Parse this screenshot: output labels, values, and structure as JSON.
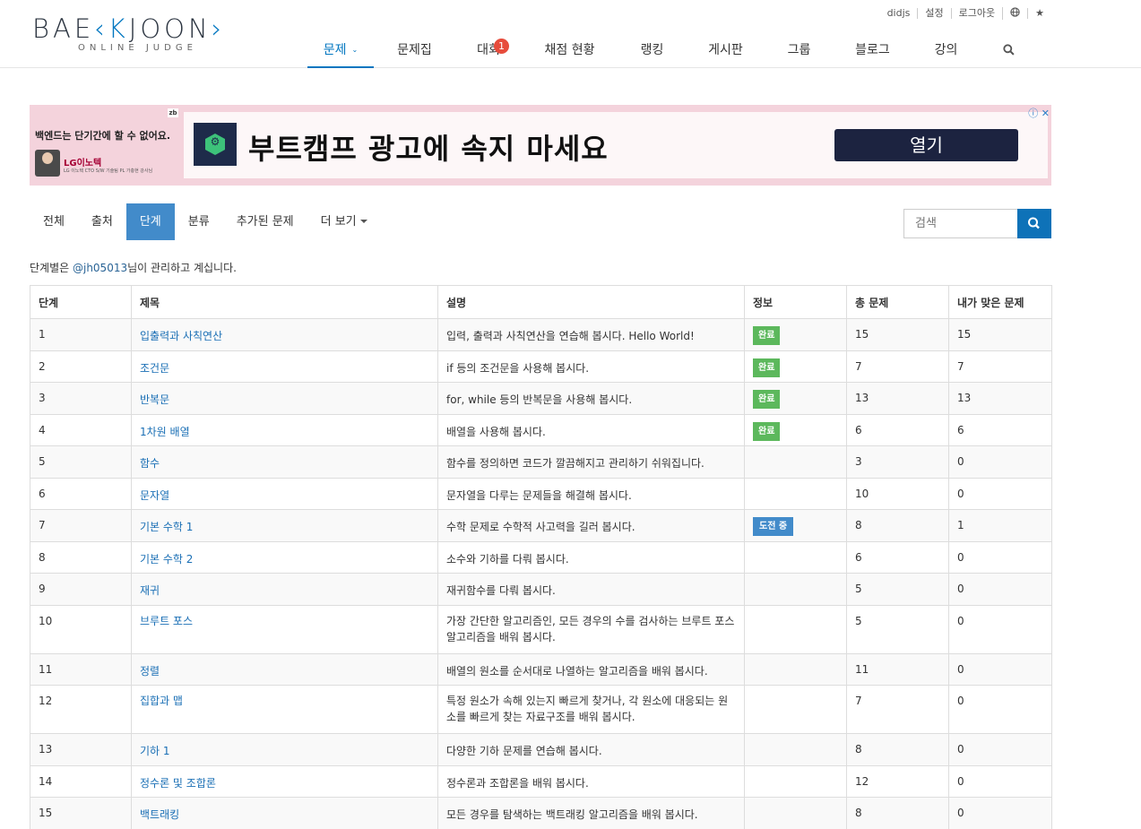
{
  "logo": {
    "main_a": "BAE",
    "main_k": "K",
    "main_b": "JOON",
    "sub": "ONLINE JUDGE"
  },
  "top_links": [
    "didjs",
    "설정",
    "로그아웃"
  ],
  "nav": {
    "items": [
      {
        "label": "문제",
        "active": true
      },
      {
        "label": "문제집"
      },
      {
        "label": "대회",
        "badge": "1"
      },
      {
        "label": "채점 현황"
      },
      {
        "label": "랭킹"
      },
      {
        "label": "게시판"
      },
      {
        "label": "그룹"
      },
      {
        "label": "블로그"
      },
      {
        "label": "강의"
      }
    ]
  },
  "ad": {
    "left_text": "백엔드는 단기간에 할 수 없어요.",
    "zb": "zb",
    "lg": "LG이노텍",
    "lg_sub": "LG 이노텍 CTO S/W 기술팀 PL 가충현 강사님",
    "headline": "부트캠프 광고에 속지 마세요",
    "button": "열기"
  },
  "subnav": {
    "tabs": [
      {
        "label": "전체"
      },
      {
        "label": "출처"
      },
      {
        "label": "단계",
        "active": true
      },
      {
        "label": "분류"
      },
      {
        "label": "추가된 문제"
      },
      {
        "label": "더 보기"
      }
    ]
  },
  "search": {
    "placeholder": "검색"
  },
  "manager": {
    "prefix": "단계별은 ",
    "user": "@jh05013",
    "suffix": "님이 관리하고 계십니다."
  },
  "table": {
    "headers": [
      "단계",
      "제목",
      "설명",
      "정보",
      "총 문제",
      "내가 맞은 문제"
    ],
    "rows": [
      {
        "step": "1",
        "title": "입출력과 사칙연산",
        "desc": "입력, 출력과 사칙연산을 연습해 봅시다. Hello World!",
        "info": "완료",
        "total": "15",
        "solved": "15"
      },
      {
        "step": "2",
        "title": "조건문",
        "desc": "if 등의 조건문을 사용해 봅시다.",
        "info": "완료",
        "total": "7",
        "solved": "7"
      },
      {
        "step": "3",
        "title": "반복문",
        "desc": "for, while 등의 반복문을 사용해 봅시다.",
        "info": "완료",
        "total": "13",
        "solved": "13"
      },
      {
        "step": "4",
        "title": "1차원 배열",
        "desc": "배열을 사용해 봅시다.",
        "info": "완료",
        "total": "6",
        "solved": "6"
      },
      {
        "step": "5",
        "title": "함수",
        "desc": "함수를 정의하면 코드가 깔끔해지고 관리하기 쉬워집니다.",
        "info": "",
        "total": "3",
        "solved": "0"
      },
      {
        "step": "6",
        "title": "문자열",
        "desc": "문자열을 다루는 문제들을 해결해 봅시다.",
        "info": "",
        "total": "10",
        "solved": "0"
      },
      {
        "step": "7",
        "title": "기본 수학 1",
        "desc": "수학 문제로 수학적 사고력을 길러 봅시다.",
        "info": "도전 중",
        "total": "8",
        "solved": "1"
      },
      {
        "step": "8",
        "title": "기본 수학 2",
        "desc": "소수와 기하를 다뤄 봅시다.",
        "info": "",
        "total": "6",
        "solved": "0"
      },
      {
        "step": "9",
        "title": "재귀",
        "desc": "재귀함수를 다뤄 봅시다.",
        "info": "",
        "total": "5",
        "solved": "0"
      },
      {
        "step": "10",
        "title": "브루트 포스",
        "desc": "가장 간단한 알고리즘인, 모든 경우의 수를 검사하는 브루트 포스 알고리즘을 배워 봅시다.",
        "info": "",
        "total": "5",
        "solved": "0",
        "tall": true
      },
      {
        "step": "11",
        "title": "정렬",
        "desc": "배열의 원소를 순서대로 나열하는 알고리즘을 배워 봅시다.",
        "info": "",
        "total": "11",
        "solved": "0"
      },
      {
        "step": "12",
        "title": "집합과 맵",
        "desc": "특정 원소가 속해 있는지 빠르게 찾거나, 각 원소에 대응되는 원소를 빠르게 찾는 자료구조를 배워 봅시다.",
        "info": "",
        "total": "7",
        "solved": "0",
        "tall": true
      },
      {
        "step": "13",
        "title": "기하 1",
        "desc": "다양한 기하 문제를 연습해 봅시다.",
        "info": "",
        "total": "8",
        "solved": "0"
      },
      {
        "step": "14",
        "title": "정수론 및 조합론",
        "desc": "정수론과 조합론을 배워 봅시다.",
        "info": "",
        "total": "12",
        "solved": "0"
      },
      {
        "step": "15",
        "title": "백트래킹",
        "desc": "모든 경우를 탐색하는 백트래킹 알고리즘을 배워 봅시다.",
        "info": "",
        "total": "8",
        "solved": "0"
      }
    ]
  },
  "colors": {
    "accent": "#0076c0",
    "done": "#5cb85c",
    "trying": "#428bca",
    "ad_bg": "#f4d3dc"
  }
}
